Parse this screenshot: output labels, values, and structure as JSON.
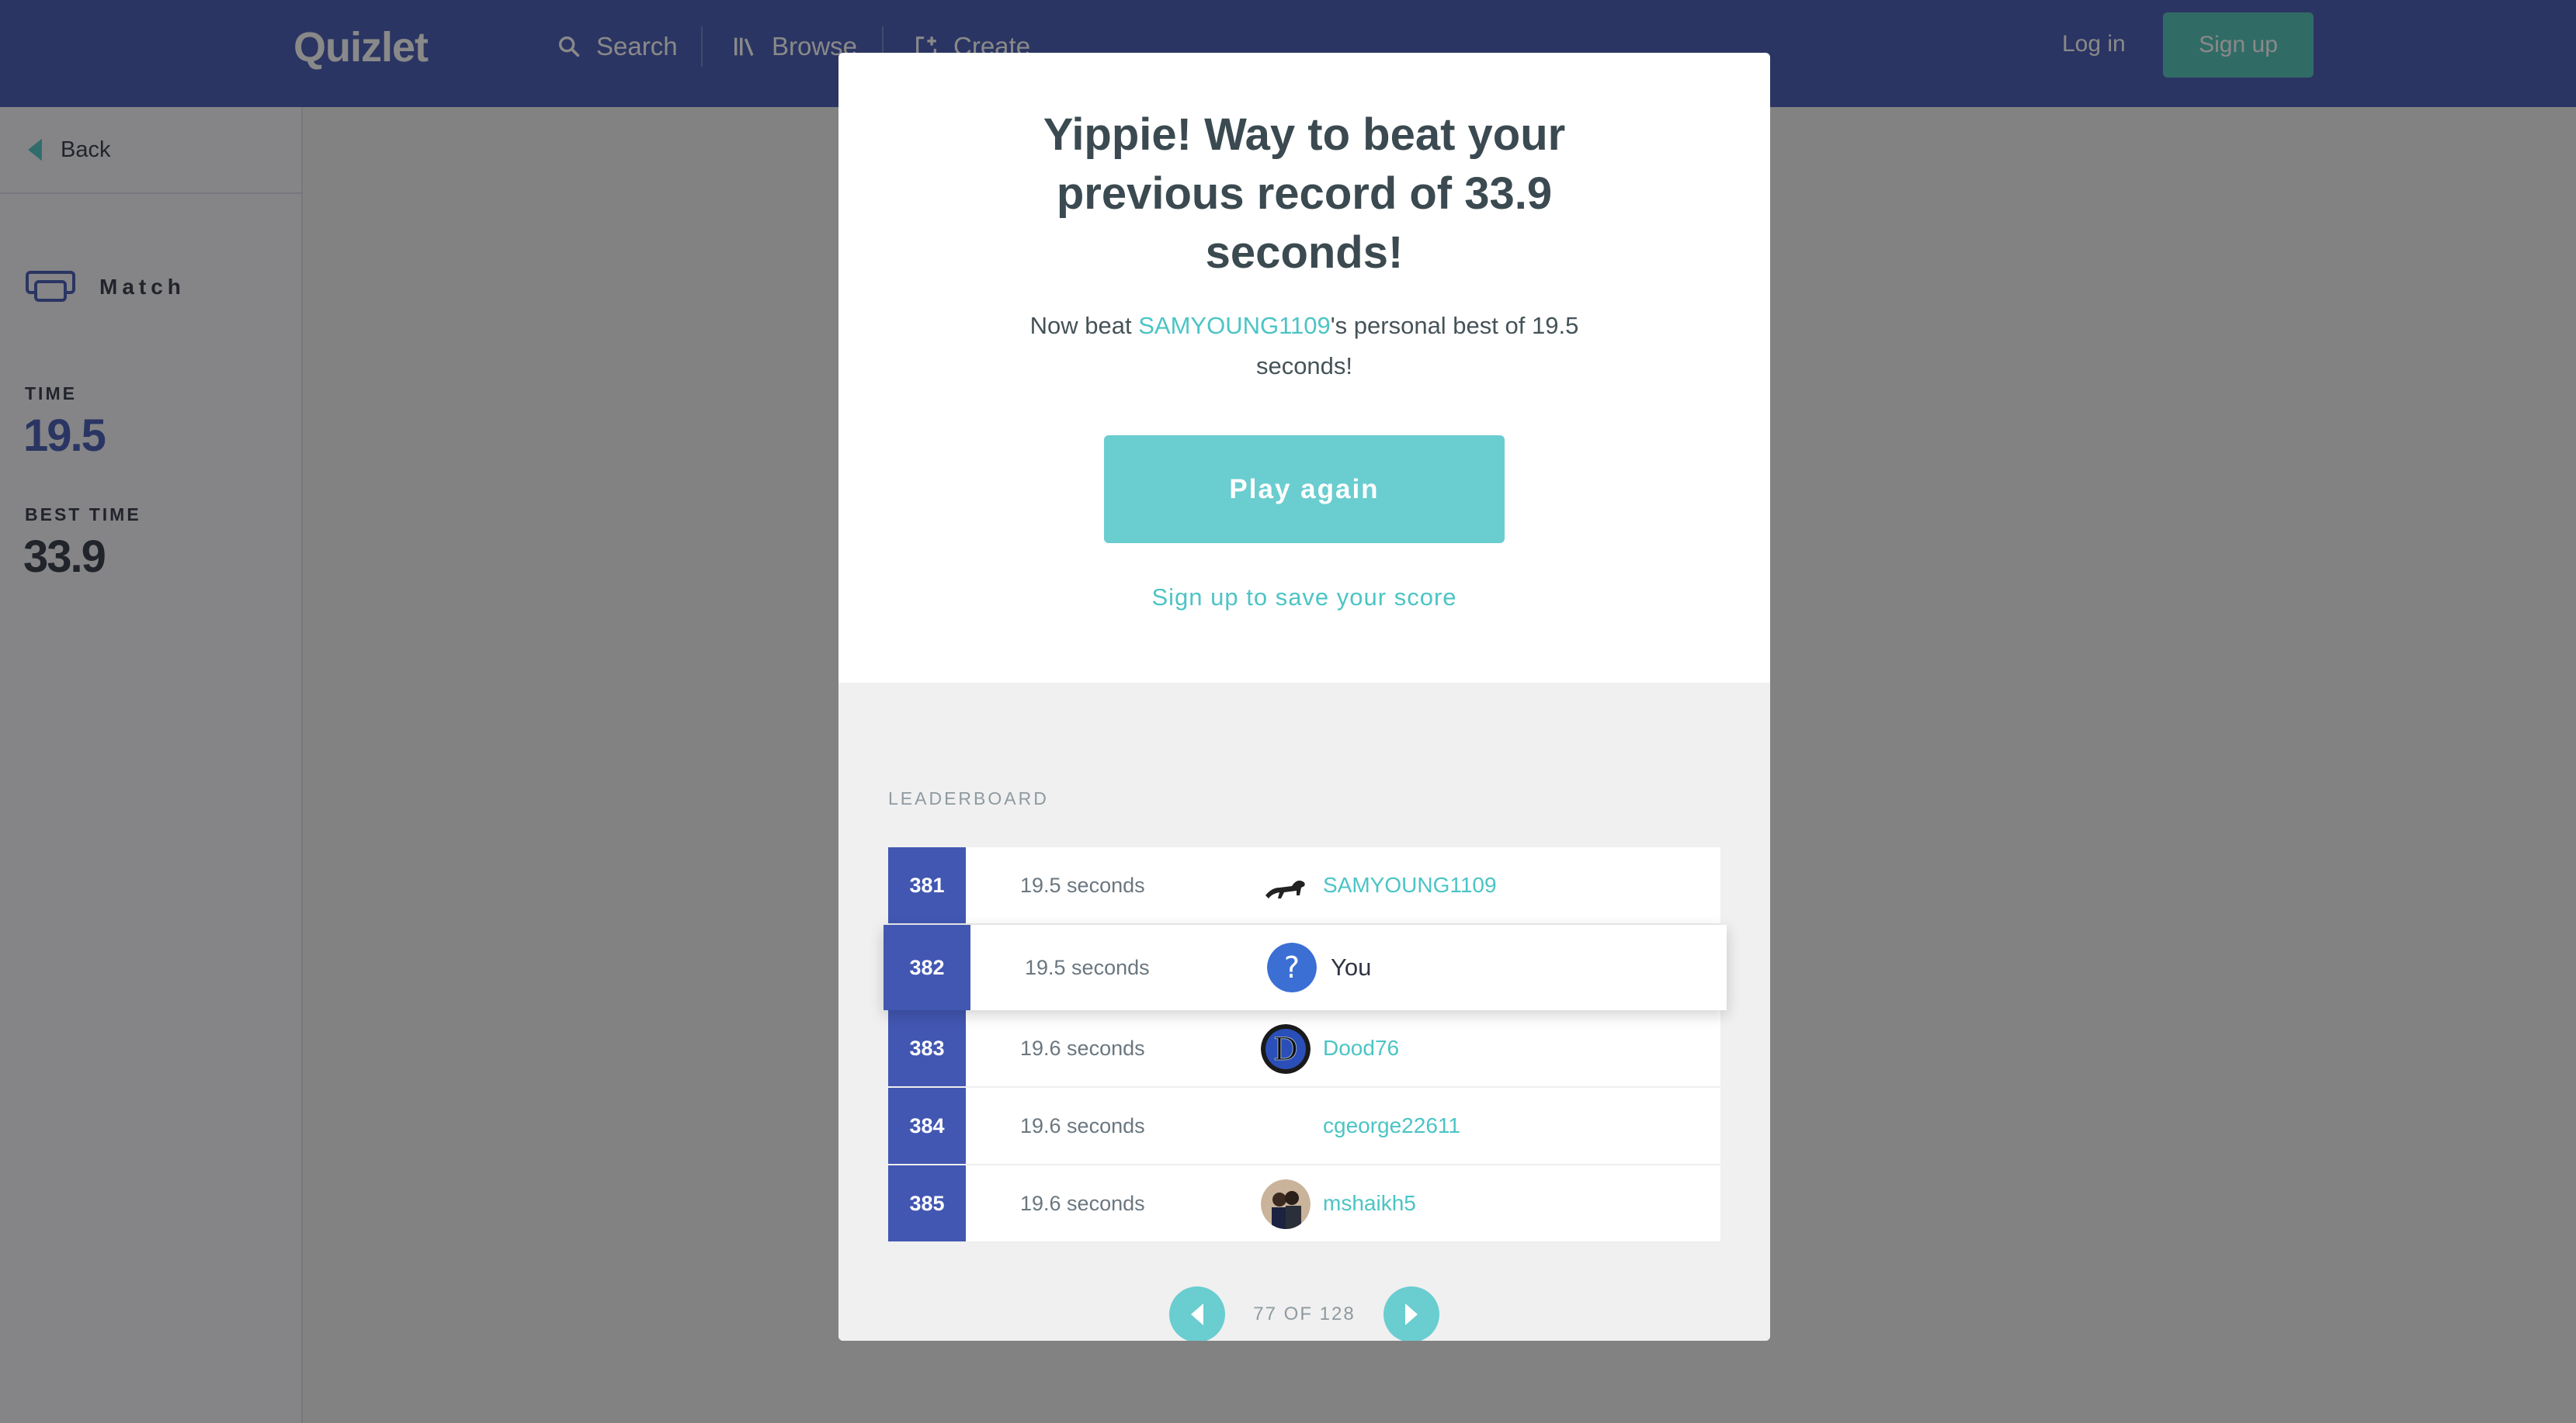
{
  "header": {
    "logo": "Quizlet",
    "nav": [
      {
        "label": "Search",
        "icon": "search-icon"
      },
      {
        "label": "Browse",
        "icon": "library-icon"
      },
      {
        "label": "Create",
        "icon": "create-icon"
      }
    ],
    "login_label": "Log in",
    "signup_label": "Sign up"
  },
  "sidebar": {
    "back_label": "Back",
    "mode_label": "Match",
    "time_label": "TIME",
    "time_value": "19.5",
    "best_time_label": "BEST TIME",
    "best_time_value": "33.9"
  },
  "modal": {
    "title": "Yippie! Way to beat your previous record of 33.9 seconds!",
    "subtitle_prefix": "Now beat ",
    "subtitle_user": "SAMYOUNG1109",
    "subtitle_suffix": "'s personal best of 19.5 seconds!",
    "play_again_label": "Play again",
    "save_score_label": "Sign up to save your score",
    "leaderboard": {
      "heading": "LEADERBOARD",
      "rows": [
        {
          "rank": "381",
          "time": "19.5 seconds",
          "user": "SAMYOUNG1109",
          "avatar": "cheetah-avatar",
          "is_you": false
        },
        {
          "rank": "382",
          "time": "19.5 seconds",
          "user": "You",
          "avatar": "question-mark-avatar",
          "is_you": true
        },
        {
          "rank": "383",
          "time": "19.6 seconds",
          "user": "Dood76",
          "avatar": "letter-d-avatar",
          "is_you": false
        },
        {
          "rank": "384",
          "time": "19.6 seconds",
          "user": "cgeorge22611",
          "avatar": "",
          "is_you": false
        },
        {
          "rank": "385",
          "time": "19.6 seconds",
          "user": "mshaikh5",
          "avatar": "photo-avatar",
          "is_you": false
        }
      ],
      "pager_label": "77 OF 128"
    }
  },
  "colors": {
    "nav_bg": "#4257b2",
    "accent_teal": "#4cc4c5",
    "button_teal": "#6acdd0",
    "rank_bg": "#4257b2",
    "time_value": "#4257b2"
  }
}
